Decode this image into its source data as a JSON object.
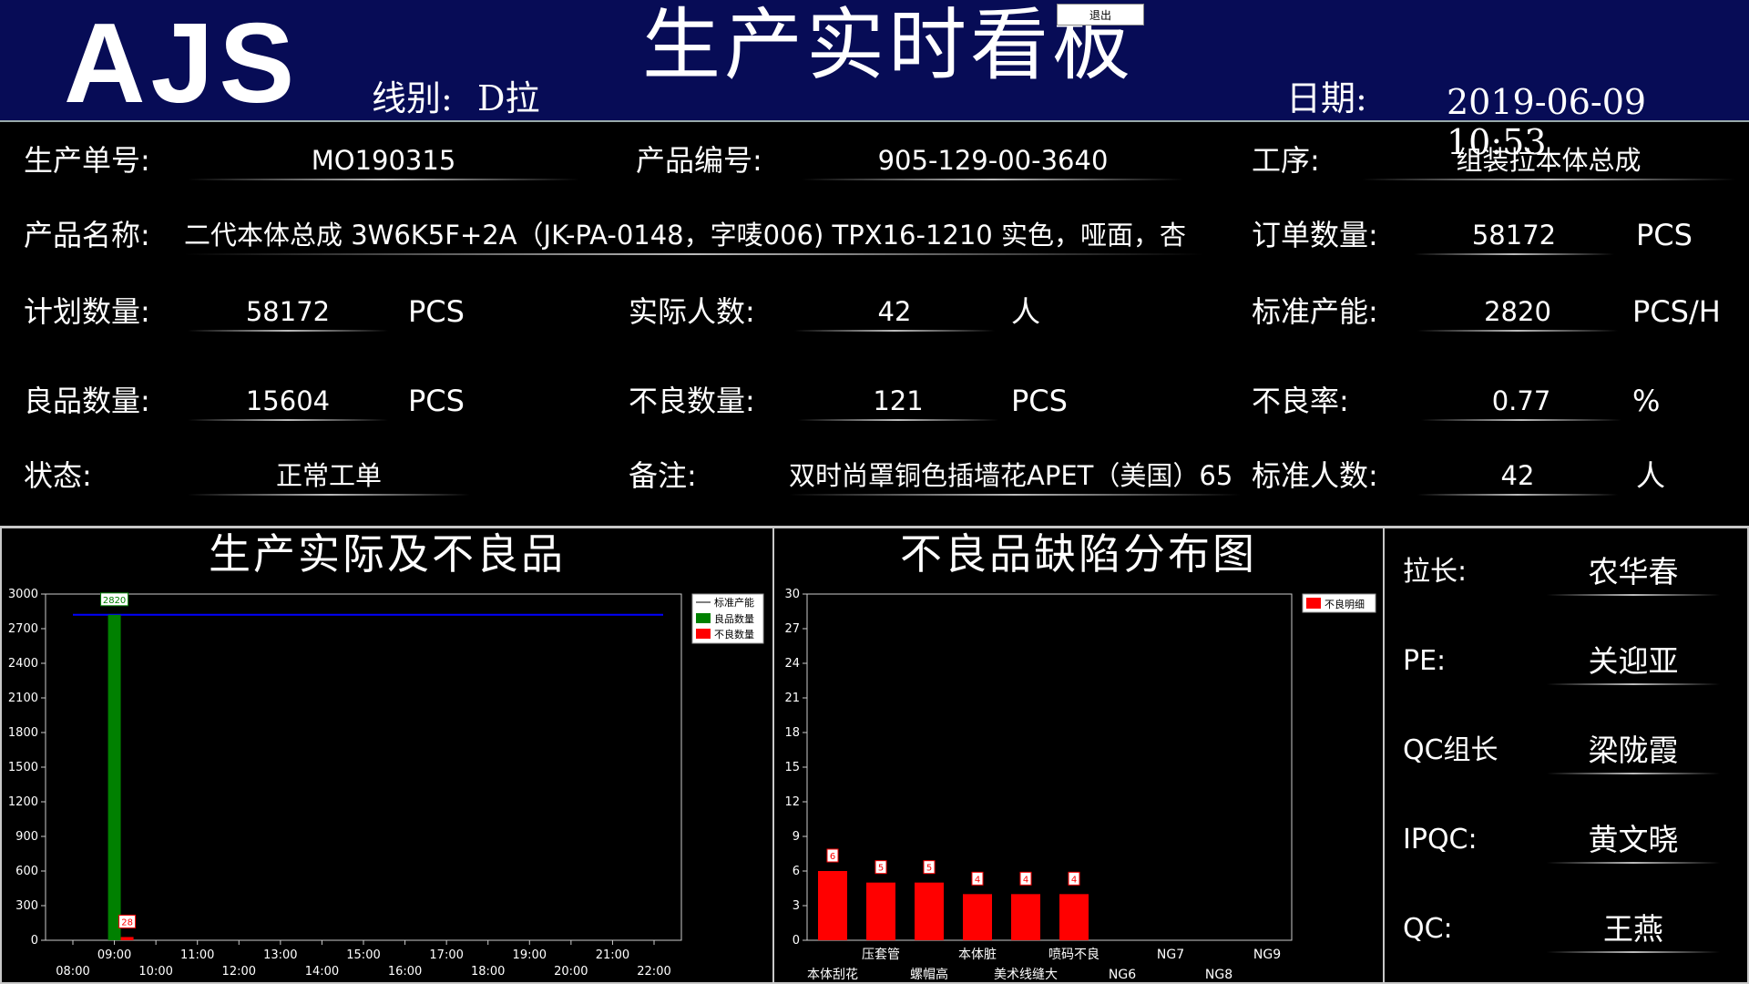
{
  "header": {
    "logo": "AJS",
    "title": "生产实时看板",
    "exit_label": "退出",
    "line_label": "线别:",
    "line_value": "D拉",
    "date_label": "日期:",
    "datetime": "2019-06-09 10:53"
  },
  "info": {
    "order_no_label": "生产单号:",
    "order_no": "MO190315",
    "product_code_label": "产品编号:",
    "product_code": "905-129-00-3640",
    "process_label": "工序:",
    "process": "组装拉本体总成",
    "product_name_label": "产品名称:",
    "product_name": "二代本体总成 3W6K5F+2A（JK-PA-0148，字唛006) TPX16-1210 实色，哑面，杏",
    "order_qty_label": "订单数量:",
    "order_qty": "58172",
    "order_qty_unit": "PCS",
    "plan_qty_label": "计划数量:",
    "plan_qty": "58172",
    "plan_qty_unit": "PCS",
    "actual_people_label": "实际人数:",
    "actual_people": "42",
    "actual_people_unit": "人",
    "std_capacity_label": "标准产能:",
    "std_capacity": "2820",
    "std_capacity_unit": "PCS/H",
    "good_qty_label": "良品数量:",
    "good_qty": "15604",
    "good_qty_unit": "PCS",
    "defect_qty_label": "不良数量:",
    "defect_qty": "121",
    "defect_qty_unit": "PCS",
    "defect_rate_label": "不良率:",
    "defect_rate": "0.77",
    "defect_rate_unit": "%",
    "status_label": "状态:",
    "status": "正常工单",
    "remark_label": "备注:",
    "remark": "双时尚罩铜色插墙花APET（美国）65",
    "std_people_label": "标准人数:",
    "std_people": "42",
    "std_people_unit": "人"
  },
  "personnel": [
    {
      "role": "拉长:",
      "name": "农华春"
    },
    {
      "role": "PE:",
      "name": "关迎亚"
    },
    {
      "role": "QC组长",
      "name": "梁陇霞"
    },
    {
      "role": "IPQC:",
      "name": "黄文晓"
    },
    {
      "role": "QC:",
      "name": "王燕"
    }
  ],
  "chart_data": [
    {
      "type": "bar",
      "title": "生产实际及不良品",
      "categories": [
        "08:00",
        "09:00",
        "10:00",
        "11:00",
        "12:00",
        "13:00",
        "14:00",
        "15:00",
        "16:00",
        "17:00",
        "18:00",
        "19:00",
        "20:00",
        "21:00",
        "22:00"
      ],
      "series": [
        {
          "name": "良品数量",
          "color": "#008000",
          "values": [
            null,
            2820,
            null,
            null,
            null,
            null,
            null,
            null,
            null,
            null,
            null,
            null,
            null,
            null,
            null
          ]
        },
        {
          "name": "不良数量",
          "color": "#ff0000",
          "values": [
            null,
            28,
            null,
            null,
            null,
            null,
            null,
            null,
            null,
            null,
            null,
            null,
            null,
            null,
            null
          ]
        }
      ],
      "reference_line": {
        "name": "标准产能",
        "color": "#0000ff",
        "value": 2820
      },
      "data_labels": {
        "good": "2820",
        "bad": "28"
      },
      "yticks": [
        "0",
        "300",
        "600",
        "900",
        "1200",
        "1500",
        "1800",
        "2100",
        "2400",
        "2700",
        "3000"
      ],
      "ylim": [
        0,
        3000
      ],
      "legend": "top-right",
      "grid": false
    },
    {
      "type": "bar",
      "title": "不良品缺陷分布图",
      "categories": [
        "本体刮花",
        "压套管",
        "螺帽高",
        "本体脏",
        "美术线缝大",
        "喷码不良",
        "NG6",
        "NG7",
        "NG8",
        "NG9"
      ],
      "series": [
        {
          "name": "不良明细",
          "color": "#ff0000",
          "values": [
            6,
            5,
            5,
            4,
            4,
            4,
            0,
            0,
            0,
            0
          ]
        }
      ],
      "data_labels": [
        "6",
        "5",
        "5",
        "4",
        "4",
        "4"
      ],
      "yticks": [
        "0",
        "3",
        "6",
        "9",
        "12",
        "15",
        "18",
        "21",
        "24",
        "27",
        "30"
      ],
      "ylim": [
        0,
        30
      ],
      "legend": "top-right",
      "grid": false
    }
  ]
}
